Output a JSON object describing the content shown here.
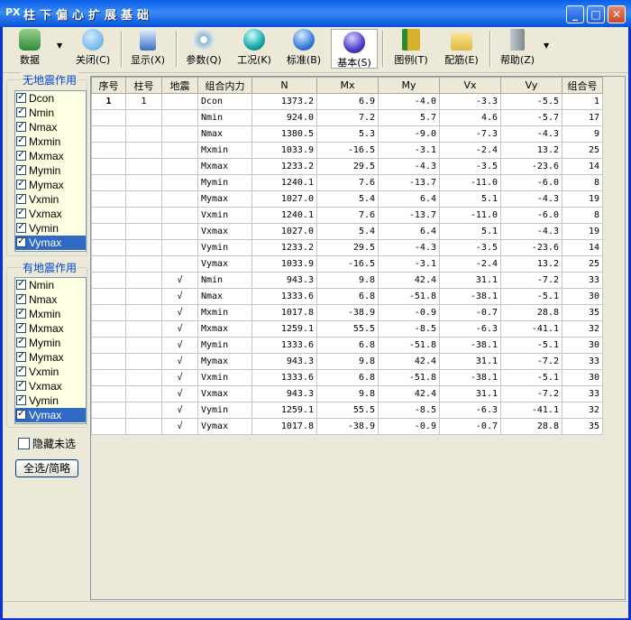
{
  "window": {
    "logo": "PX",
    "title": "柱下偏心扩展基础",
    "buttons": {
      "minimize": "_",
      "maximize": "□",
      "close": "✕"
    }
  },
  "toolbar": {
    "items": [
      {
        "label": "数据",
        "icon": "database-icon",
        "color": "#2e8b3a"
      },
      {
        "label": "关闭(C)",
        "icon": "close-file-icon",
        "color": "#4aa0e0"
      },
      {
        "label": "显示(X)",
        "icon": "display-icon",
        "color": "#3b6fc0"
      },
      {
        "label": "参数(Q)",
        "icon": "cd-icon",
        "color": "#8fb8d0"
      },
      {
        "label": "工况(K)",
        "icon": "teal-sphere-icon",
        "color": "#19a8a8"
      },
      {
        "label": "标准(B)",
        "icon": "blue-sphere-icon",
        "color": "#3a7fd8"
      },
      {
        "label": "基本(S)",
        "icon": "purple-sphere-icon",
        "color": "#4a3fc8"
      },
      {
        "label": "图例(T)",
        "icon": "legend-icon",
        "color": "#d8b030"
      },
      {
        "label": "配筋(E)",
        "icon": "folder-gear-icon",
        "color": "#e0b840"
      },
      {
        "label": "帮助(Z)",
        "icon": "help-icon",
        "color": "#808890"
      }
    ]
  },
  "left": {
    "group1_title": "无地震作用",
    "group1_items": [
      "Dcon",
      "Nmin",
      "Nmax",
      "Mxmin",
      "Mxmax",
      "Mymin",
      "Mymax",
      "Vxmin",
      "Vxmax",
      "Vymin",
      "Vymax"
    ],
    "group2_title": "有地震作用",
    "group2_items": [
      "Nmin",
      "Nmax",
      "Mxmin",
      "Mxmax",
      "Mymin",
      "Mymax",
      "Vxmin",
      "Vxmax",
      "Vymin",
      "Vymax"
    ],
    "hide_label": "隐藏未选",
    "select_button": "全选/简略",
    "check_mark": "✓"
  },
  "table": {
    "headers": [
      "序号",
      "柱号",
      "地震",
      "组合内力",
      "N",
      "Mx",
      "My",
      "Vx",
      "Vy",
      "组合号"
    ],
    "rows": [
      [
        "1",
        "1",
        "",
        "Dcon",
        "1373.2",
        "6.9",
        "-4.0",
        "-3.3",
        "-5.5",
        "1"
      ],
      [
        "",
        "",
        "",
        "Nmin",
        "924.0",
        "7.2",
        "5.7",
        "4.6",
        "-5.7",
        "17"
      ],
      [
        "",
        "",
        "",
        "Nmax",
        "1380.5",
        "5.3",
        "-9.0",
        "-7.3",
        "-4.3",
        "9"
      ],
      [
        "",
        "",
        "",
        "Mxmin",
        "1033.9",
        "-16.5",
        "-3.1",
        "-2.4",
        "13.2",
        "25"
      ],
      [
        "",
        "",
        "",
        "Mxmax",
        "1233.2",
        "29.5",
        "-4.3",
        "-3.5",
        "-23.6",
        "14"
      ],
      [
        "",
        "",
        "",
        "Mymin",
        "1240.1",
        "7.6",
        "-13.7",
        "-11.0",
        "-6.0",
        "8"
      ],
      [
        "",
        "",
        "",
        "Mymax",
        "1027.0",
        "5.4",
        "6.4",
        "5.1",
        "-4.3",
        "19"
      ],
      [
        "",
        "",
        "",
        "Vxmin",
        "1240.1",
        "7.6",
        "-13.7",
        "-11.0",
        "-6.0",
        "8"
      ],
      [
        "",
        "",
        "",
        "Vxmax",
        "1027.0",
        "5.4",
        "6.4",
        "5.1",
        "-4.3",
        "19"
      ],
      [
        "",
        "",
        "",
        "Vymin",
        "1233.2",
        "29.5",
        "-4.3",
        "-3.5",
        "-23.6",
        "14"
      ],
      [
        "",
        "",
        "",
        "Vymax",
        "1033.9",
        "-16.5",
        "-3.1",
        "-2.4",
        "13.2",
        "25"
      ],
      [
        "",
        "",
        "√",
        "Nmin",
        "943.3",
        "9.8",
        "42.4",
        "31.1",
        "-7.2",
        "33"
      ],
      [
        "",
        "",
        "√",
        "Nmax",
        "1333.6",
        "6.8",
        "-51.8",
        "-38.1",
        "-5.1",
        "30"
      ],
      [
        "",
        "",
        "√",
        "Mxmin",
        "1017.8",
        "-38.9",
        "-0.9",
        "-0.7",
        "28.8",
        "35"
      ],
      [
        "",
        "",
        "√",
        "Mxmax",
        "1259.1",
        "55.5",
        "-8.5",
        "-6.3",
        "-41.1",
        "32"
      ],
      [
        "",
        "",
        "√",
        "Mymin",
        "1333.6",
        "6.8",
        "-51.8",
        "-38.1",
        "-5.1",
        "30"
      ],
      [
        "",
        "",
        "√",
        "Mymax",
        "943.3",
        "9.8",
        "42.4",
        "31.1",
        "-7.2",
        "33"
      ],
      [
        "",
        "",
        "√",
        "Vxmin",
        "1333.6",
        "6.8",
        "-51.8",
        "-38.1",
        "-5.1",
        "30"
      ],
      [
        "",
        "",
        "√",
        "Vxmax",
        "943.3",
        "9.8",
        "42.4",
        "31.1",
        "-7.2",
        "33"
      ],
      [
        "",
        "",
        "√",
        "Vymin",
        "1259.1",
        "55.5",
        "-8.5",
        "-6.3",
        "-41.1",
        "32"
      ],
      [
        "",
        "",
        "√",
        "Vymax",
        "1017.8",
        "-38.9",
        "-0.9",
        "-0.7",
        "28.8",
        "35"
      ]
    ]
  }
}
